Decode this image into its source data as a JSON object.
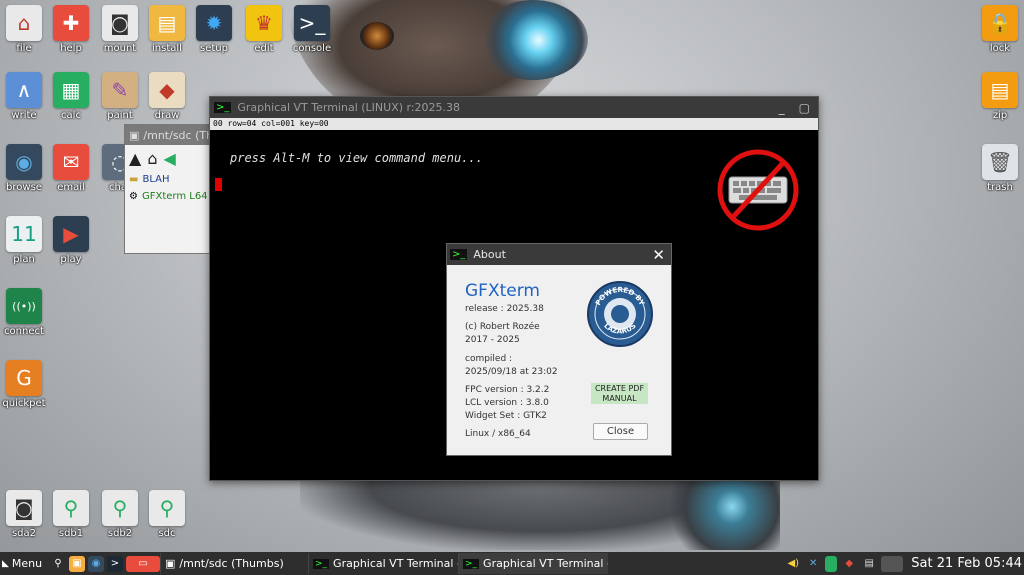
{
  "desktop": {
    "icons": [
      {
        "id": "file",
        "label": "file",
        "glyph": "⌂",
        "color": "#e9e9e9",
        "fg": "#c0392b"
      },
      {
        "id": "help",
        "label": "help",
        "glyph": "✚",
        "color": "#e74c3c",
        "fg": "#fff"
      },
      {
        "id": "mount",
        "label": "mount",
        "glyph": "◙",
        "color": "#e9e9e9",
        "fg": "#333"
      },
      {
        "id": "install",
        "label": "install",
        "glyph": "▤",
        "color": "#f0b840",
        "fg": "#fff"
      },
      {
        "id": "setup",
        "label": "setup",
        "glyph": "✹",
        "color": "#2c3e50",
        "fg": "#3fa9f5"
      },
      {
        "id": "edit",
        "label": "edit",
        "glyph": "♛",
        "color": "#f1c40f",
        "fg": "#c0392b"
      },
      {
        "id": "console",
        "label": "console",
        "glyph": ">_",
        "color": "#2c3e50",
        "fg": "#fff"
      },
      {
        "id": "write",
        "label": "write",
        "glyph": "∧",
        "color": "#5d8fd6",
        "fg": "#fff"
      },
      {
        "id": "calc",
        "label": "calc",
        "glyph": "▦",
        "color": "#27ae60",
        "fg": "#fff"
      },
      {
        "id": "paint",
        "label": "paint",
        "glyph": "✎",
        "color": "#d3b082",
        "fg": "#8e44ad"
      },
      {
        "id": "draw",
        "label": "draw",
        "glyph": "◆",
        "color": "#e9dcc0",
        "fg": "#c0392b"
      },
      {
        "id": "browse",
        "label": "browse",
        "glyph": "◉",
        "color": "#34495e",
        "fg": "#5dade2"
      },
      {
        "id": "email",
        "label": "email",
        "glyph": "✉",
        "color": "#e74c3c",
        "fg": "#fff"
      },
      {
        "id": "chat",
        "label": "chat",
        "glyph": "◌",
        "color": "#5d6d7e",
        "fg": "#fff"
      },
      {
        "id": "plan",
        "label": "plan",
        "glyph": "11",
        "color": "#ecf0f1",
        "fg": "#16a085"
      },
      {
        "id": "play",
        "label": "play",
        "glyph": "▶",
        "color": "#2c3e50",
        "fg": "#e74c3c"
      },
      {
        "id": "connect",
        "label": "connect",
        "glyph": "((•))",
        "color": "#1e8449",
        "fg": "#fff"
      },
      {
        "id": "quickpet",
        "label": "quickpet",
        "glyph": "G",
        "color": "#e67e22",
        "fg": "#fff"
      },
      {
        "id": "sda2",
        "label": "sda2",
        "glyph": "◙",
        "color": "#e9e9e9",
        "fg": "#333"
      },
      {
        "id": "sdb1",
        "label": "sdb1",
        "glyph": "⚲",
        "color": "#e9e9e9",
        "fg": "#27ae60"
      },
      {
        "id": "sdb2",
        "label": "sdb2",
        "glyph": "⚲",
        "color": "#e9e9e9",
        "fg": "#27ae60"
      },
      {
        "id": "sdc",
        "label": "sdc",
        "glyph": "⚲",
        "color": "#e9e9e9",
        "fg": "#27ae60"
      },
      {
        "id": "lock",
        "label": "lock",
        "glyph": "🔒",
        "color": "#f39c12",
        "fg": "#fff"
      },
      {
        "id": "zip",
        "label": "zip",
        "glyph": "▤",
        "color": "#f39c12",
        "fg": "#fff"
      },
      {
        "id": "trash",
        "label": "trash",
        "glyph": "🗑",
        "color": "#dde3e6",
        "fg": "#555"
      }
    ]
  },
  "file_manager": {
    "title": "/mnt/sdc (Th",
    "items": [
      {
        "label": "BLAH",
        "icon": "folder-icon",
        "color": "#1a3d8f"
      },
      {
        "label": "GFXterm L64",
        "icon": "gear-icon",
        "color": "#1e7d1e"
      }
    ]
  },
  "terminal": {
    "title": "Graphical VT Terminal (LINUX)   r:2025.38",
    "status": "00 row=04 col=001 key=00",
    "prompt": "press Alt-M to view command menu...",
    "minimize": "_",
    "maximize": "▢"
  },
  "about": {
    "title": "About",
    "app_name": "GFXterm",
    "release": "release : 2025.38",
    "copyright": "(c) Robert Rozée",
    "years": "2017 - 2025",
    "compiled_label": "compiled :",
    "compiled_value": "2025/09/18  at  23:02",
    "fpc": "FPC version :  3.2.2",
    "lcl": "LCL version :  3.8.0",
    "widget": "Widget Set  :  GTK2",
    "platform": "Linux  /  x86_64",
    "badge_top": "POWERED BY",
    "badge_bottom": "LAZARUS",
    "pdf_button": "CREATE PDF MANUAL",
    "close_button": "Close"
  },
  "taskbar": {
    "menu_label": "Menu",
    "tasks": [
      {
        "label": "/mnt/sdc (Thumbs)",
        "icon": "file-manager-icon"
      },
      {
        "label": "Graphical VT Terminal (LIN",
        "icon": "terminal-icon"
      },
      {
        "label": "Graphical VT Terminal (LIN",
        "icon": "terminal-icon"
      }
    ],
    "clock": "Sat 21 Feb 05:44"
  }
}
